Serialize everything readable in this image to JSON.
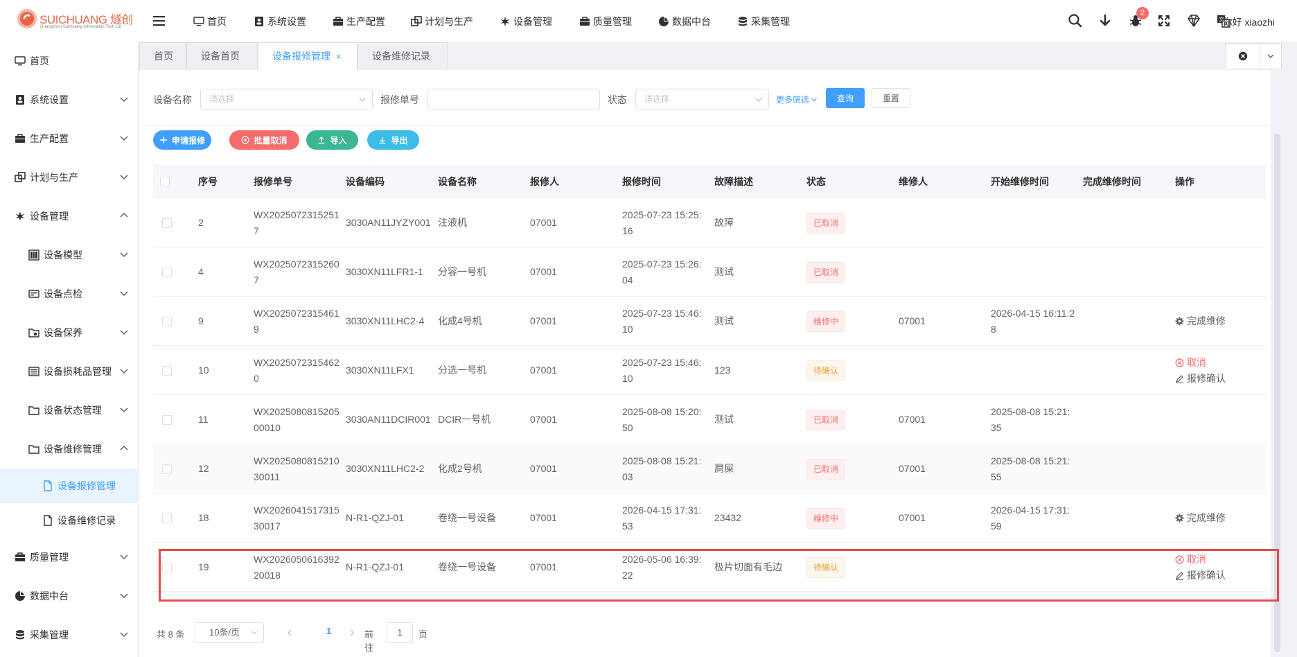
{
  "brand": {
    "name": "SUICHUANG 燧创",
    "subtitle": "Guangzhou Suichuang Information Tech Ltd"
  },
  "topnav": [
    {
      "label": "首页",
      "icon": "monitor-icon"
    },
    {
      "label": "系统设置",
      "icon": "user-card-icon"
    },
    {
      "label": "生产配置",
      "icon": "briefcase-icon"
    },
    {
      "label": "计划与生产",
      "icon": "windows-icon"
    },
    {
      "label": "设备管理",
      "icon": "gear-star-icon"
    },
    {
      "label": "质量管理",
      "icon": "briefcase-icon"
    },
    {
      "label": "数据中台",
      "icon": "pie-chart-icon"
    },
    {
      "label": "采集管理",
      "icon": "database-icon"
    }
  ],
  "header_right": {
    "notification_count": "2",
    "greeting": "你好 xiaozhi"
  },
  "sidebar": {
    "items": [
      {
        "label": "首页"
      },
      {
        "label": "系统设置"
      },
      {
        "label": "生产配置"
      },
      {
        "label": "计划与生产"
      },
      {
        "label": "设备管理"
      },
      {
        "label": "设备模型"
      },
      {
        "label": "设备点检"
      },
      {
        "label": "设备保养"
      },
      {
        "label": "设备损耗品管理"
      },
      {
        "label": "设备状态管理"
      },
      {
        "label": "设备维修管理"
      },
      {
        "label": "设备报修管理"
      },
      {
        "label": "设备维修记录"
      },
      {
        "label": "质量管理"
      },
      {
        "label": "数据中台"
      },
      {
        "label": "采集管理"
      }
    ]
  },
  "tabs": [
    {
      "label": "首页"
    },
    {
      "label": "设备首页"
    },
    {
      "label": "设备报修管理",
      "close": "×"
    },
    {
      "label": "设备维修记录"
    }
  ],
  "filters": {
    "device_name_label": "设备名称",
    "device_name_placeholder": "请选择",
    "repair_no_label": "报修单号",
    "repair_no_value": "",
    "status_label": "状态",
    "status_placeholder": "请选择",
    "more_label": "更多筛选",
    "query_label": "查询",
    "reset_label": "重置"
  },
  "actions": {
    "apply_repair": "申请报修",
    "batch_cancel": "批量取消",
    "import": "导入",
    "export": "导出"
  },
  "table": {
    "columns": [
      "序号",
      "报修单号",
      "设备编码",
      "设备名称",
      "报修人",
      "报修时间",
      "故障描述",
      "状态",
      "维修人",
      "开始维修时间",
      "完成维修时间",
      "操作"
    ],
    "rows": [
      {
        "no": "2",
        "repair_no": "WX20250723152517",
        "code": "3030AN11JYZY001",
        "name": "注液机",
        "reporter": "07001",
        "report_time": "2025-07-23 15:25:16",
        "desc": "故障",
        "status": "已取消",
        "status_type": "cancelled",
        "repairer": "",
        "start_time": "",
        "finish_time": "",
        "ops": []
      },
      {
        "no": "4",
        "repair_no": "WX20250723152607",
        "code": "3030XN11LFR1-1",
        "name": "分容一号机",
        "reporter": "07001",
        "report_time": "2025-07-23 15:26:04",
        "desc": "测试",
        "status": "已取消",
        "status_type": "cancelled",
        "repairer": "",
        "start_time": "",
        "finish_time": "",
        "ops": []
      },
      {
        "no": "9",
        "repair_no": "WX20250723154619",
        "code": "3030XN11LHC2-4",
        "name": "化成4号机",
        "reporter": "07001",
        "report_time": "2025-07-23 15:46:10",
        "desc": "测试",
        "status": "维修中",
        "status_type": "repairing",
        "repairer": "07001",
        "start_time": "2026-04-15 16:11:28",
        "finish_time": "",
        "ops": [
          {
            "label": "完成维修",
            "type": "normal",
            "icon": "gear-icon"
          }
        ]
      },
      {
        "no": "10",
        "repair_no": "WX20250723154620",
        "code": "3030XN11LFX1",
        "name": "分选一号机",
        "reporter": "07001",
        "report_time": "2025-07-23 15:46:10",
        "desc": "123",
        "status": "待确认",
        "status_type": "pending",
        "repairer": "",
        "start_time": "",
        "finish_time": "",
        "ops": [
          {
            "label": "取消",
            "type": "cancel",
            "icon": "circle-x-icon"
          },
          {
            "label": "报修确认",
            "type": "normal",
            "icon": "edit-icon"
          }
        ]
      },
      {
        "no": "11",
        "repair_no": "WX202508081520500010",
        "code": "3030AN11DCIR001",
        "name": "DCIR一号机",
        "reporter": "07001",
        "report_time": "2025-08-08 15:20:50",
        "desc": "测试",
        "status": "已取消",
        "status_type": "cancelled",
        "repairer": "07001",
        "start_time": "2025-08-08 15:21:35",
        "finish_time": "",
        "ops": []
      },
      {
        "no": "12",
        "repair_no": "WX202508081521030011",
        "code": "3030XN11LHC2-2",
        "name": "化成2号机",
        "reporter": "07001",
        "report_time": "2025-08-08 15:21:03",
        "desc": "屙屎",
        "status": "已取消",
        "status_type": "cancelled",
        "repairer": "07001",
        "start_time": "2025-08-08 15:21:55",
        "finish_time": "",
        "ops": []
      },
      {
        "no": "18",
        "repair_no": "WX202604151731530017",
        "code": "N-R1-QZJ-01",
        "name": "卷绕一号设备",
        "reporter": "07001",
        "report_time": "2026-04-15 17:31:53",
        "desc": "23432",
        "status": "维修中",
        "status_type": "repairing",
        "repairer": "07001",
        "start_time": "2026-04-15 17:31:59",
        "finish_time": "",
        "ops": [
          {
            "label": "完成维修",
            "type": "normal",
            "icon": "gear-icon"
          }
        ]
      },
      {
        "no": "19",
        "repair_no": "WX202605061639220018",
        "code": "N-R1-QZJ-01",
        "name": "卷绕一号设备",
        "reporter": "07001",
        "report_time": "2026-05-06 16:39:22",
        "desc": "极片切面有毛边",
        "status": "待确认",
        "status_type": "pending",
        "repairer": "",
        "start_time": "",
        "finish_time": "",
        "ops": [
          {
            "label": "取消",
            "type": "cancel",
            "icon": "circle-x-icon"
          },
          {
            "label": "报修确认",
            "type": "normal",
            "icon": "edit-icon"
          }
        ]
      }
    ]
  },
  "pagination": {
    "total": "共 8 条",
    "page_size": "10条/页",
    "current_page": "1",
    "goto_label": "前往",
    "goto_value": "1",
    "goto_suffix": "页"
  },
  "colors": {
    "primary": "#409eff",
    "danger": "#f56c6c",
    "success": "#3bb893",
    "info": "#3cbde8",
    "warning": "#e6a23c",
    "highlight": "#e34b4f"
  }
}
